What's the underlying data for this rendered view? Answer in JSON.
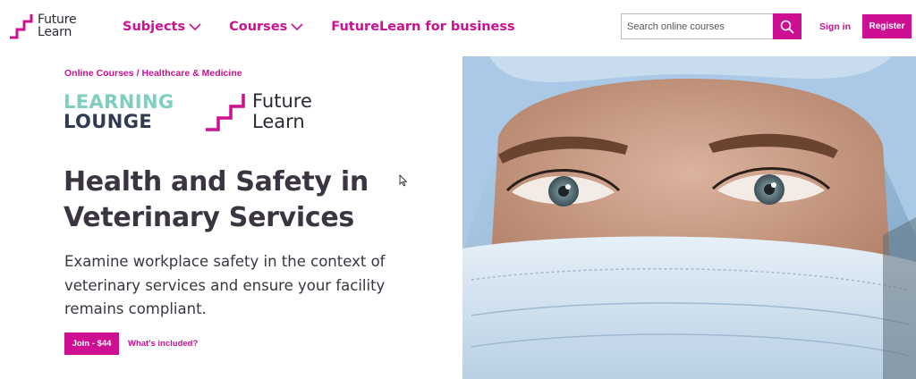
{
  "header": {
    "logo_text_line1": "Future",
    "logo_text_line2": "Learn",
    "nav": [
      {
        "label": "Subjects"
      },
      {
        "label": "Courses"
      },
      {
        "label": "FutureLearn for business"
      }
    ],
    "search_placeholder": "Search online courses",
    "signin_label": "Sign in",
    "register_label": "Register"
  },
  "breadcrumb": {
    "items": [
      "Online Courses",
      "Healthcare & Medicine"
    ],
    "separator": "/"
  },
  "partner_logo": {
    "line1": "LEARNING",
    "line2": "LOUNGE"
  },
  "futurelearn_logo": {
    "line1": "Future",
    "line2": "Learn"
  },
  "course": {
    "title": "Health and Safety in Veterinary Services",
    "description": "Examine workplace safety in the context of veterinary services and ensure your facility remains compliant.",
    "join_label": "Join - $44",
    "included_label": "What's included?"
  },
  "hero_image": {
    "alt": "Healthcare worker wearing surgical mask and cap"
  },
  "colors": {
    "brand": "#cd0f92",
    "text": "#3a3540",
    "ll_teal": "#7ecfc1",
    "ll_navy": "#2e3b52"
  }
}
